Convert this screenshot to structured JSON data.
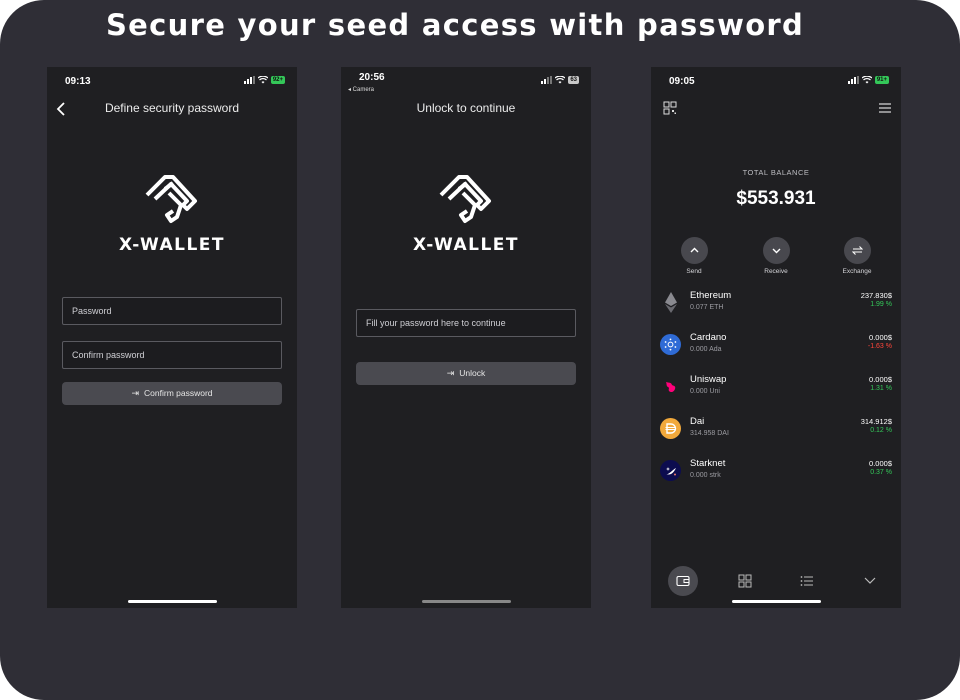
{
  "headline": "Secure your seed access with password",
  "screens": {
    "define": {
      "time": "09:13",
      "battery": "92+",
      "title": "Define security password",
      "logo_text": "X-WALLET",
      "password_placeholder": "Password",
      "confirm_placeholder": "Confirm password",
      "button_label": "Confirm password"
    },
    "unlock": {
      "time": "20:56",
      "back_label": "◂ Camera",
      "battery": "63",
      "title": "Unlock to continue",
      "logo_text": "X-WALLET",
      "password_placeholder": "Fill your password here to continue",
      "button_label": "Unlock"
    },
    "wallet": {
      "time": "09:05",
      "battery": "91+",
      "total_label": "TOTAL BALANCE",
      "total_value": "$553.931",
      "actions": [
        {
          "label": "Send",
          "icon": "chevron-up-icon"
        },
        {
          "label": "Receive",
          "icon": "chevron-down-icon"
        },
        {
          "label": "Exchange",
          "icon": "exchange-icon"
        }
      ],
      "assets": [
        {
          "name": "Ethereum",
          "amount": "0.077 ETH",
          "value": "237.830$",
          "change": "1.99 %",
          "trend": "up",
          "icon": "ethereum-icon",
          "color": "#2a2a2e"
        },
        {
          "name": "Cardano",
          "amount": "0.000 Ada",
          "value": "0.000$",
          "change": "-1.63 %",
          "trend": "down",
          "icon": "cardano-icon",
          "color": "#2f6bd6"
        },
        {
          "name": "Uniswap",
          "amount": "0.000 Uni",
          "value": "0.000$",
          "change": "1.31 %",
          "trend": "up",
          "icon": "uniswap-icon",
          "color": "#2a2a2e"
        },
        {
          "name": "Dai",
          "amount": "314.958 DAI",
          "value": "314.912$",
          "change": "0.12 %",
          "trend": "up",
          "icon": "dai-icon",
          "color": "#f2a93b"
        },
        {
          "name": "Starknet",
          "amount": "0.000 strk",
          "value": "0.000$",
          "change": "0.37 %",
          "trend": "up",
          "icon": "starknet-icon",
          "color": "#0c0c4f"
        }
      ],
      "tabs": [
        "wallet-icon",
        "grid-icon",
        "list-icon",
        "chevron-down-icon"
      ]
    }
  },
  "colors": {
    "frame": "#2f2e36",
    "screen": "#1f1f22",
    "positive": "#34c759",
    "negative": "#ff453a"
  }
}
